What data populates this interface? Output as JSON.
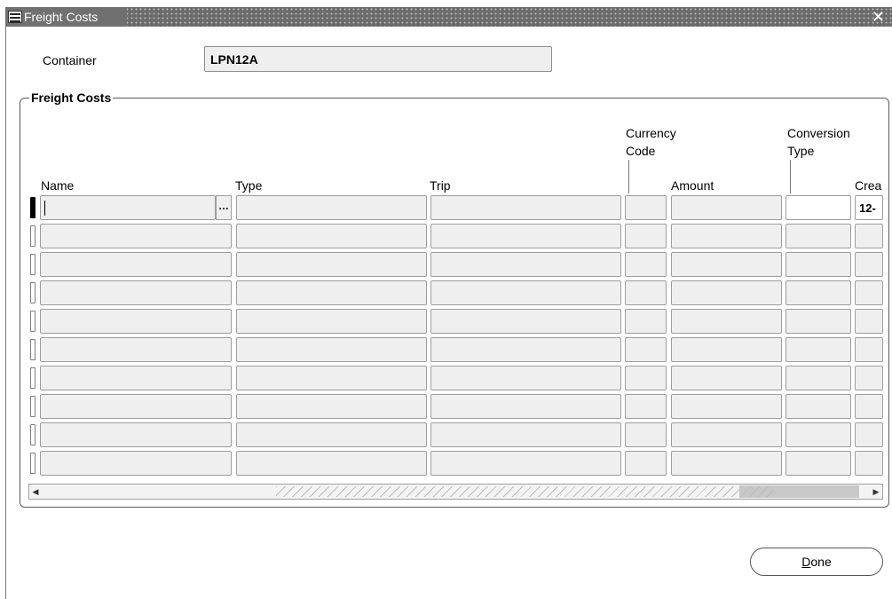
{
  "window": {
    "title": "Freight Costs",
    "close_glyph": "✕",
    "icon": "oracle-app-icon"
  },
  "header": {
    "container_label": "Container",
    "container_value": "LPN12A"
  },
  "freight_costs": {
    "section_title": "Freight Costs",
    "columns": {
      "currency_code": [
        "Currency",
        "Code"
      ],
      "conversion_type": [
        "Conversion",
        "Type"
      ],
      "name": "Name",
      "type": "Type",
      "trip": "Trip",
      "amount": "Amount",
      "created_partial": "Crea"
    },
    "first_row_created_partial": "12-",
    "lov_glyph": "…",
    "row_count": 10
  },
  "scrollbar": {
    "left_arrow": "◀",
    "right_arrow": "▶"
  },
  "actions": {
    "done_first": "D",
    "done_rest": "one"
  }
}
